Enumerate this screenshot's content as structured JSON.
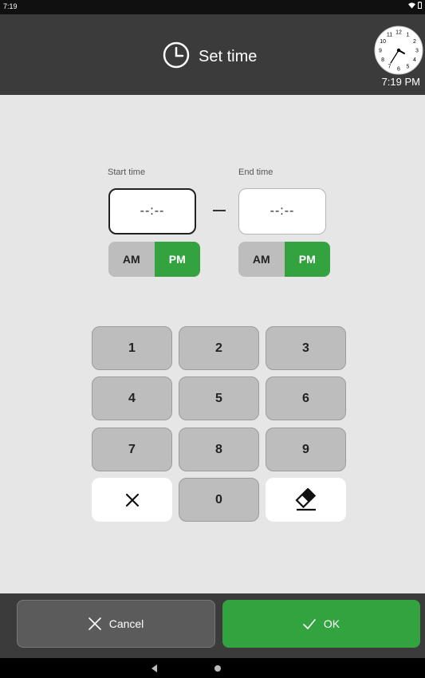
{
  "status_bar": {
    "time": "7:19",
    "icons": "wifi-icon battery-icon"
  },
  "header": {
    "title": "Set time",
    "clock_time": "7:19 PM",
    "clock_numbers": [
      "12",
      "1",
      "2",
      "3",
      "4",
      "5",
      "6",
      "7",
      "8",
      "9",
      "10",
      "11"
    ]
  },
  "start": {
    "label": "Start time",
    "value": "--:--",
    "am": "AM",
    "pm": "PM",
    "selected": "PM"
  },
  "end": {
    "label": "End time",
    "value": "--:--",
    "am": "AM",
    "pm": "PM",
    "selected": "PM"
  },
  "keypad": {
    "k1": "1",
    "k2": "2",
    "k3": "3",
    "k4": "4",
    "k5": "5",
    "k6": "6",
    "k7": "7",
    "k8": "8",
    "k9": "9",
    "k0": "0",
    "clear_icon": "close-icon",
    "erase_icon": "eraser-icon"
  },
  "buttons": {
    "cancel": "Cancel",
    "ok": "OK"
  },
  "colors": {
    "accent": "#32a33f",
    "header": "#3b3b3b",
    "key": "#bdbdbd",
    "background": "#e6e6e6"
  }
}
